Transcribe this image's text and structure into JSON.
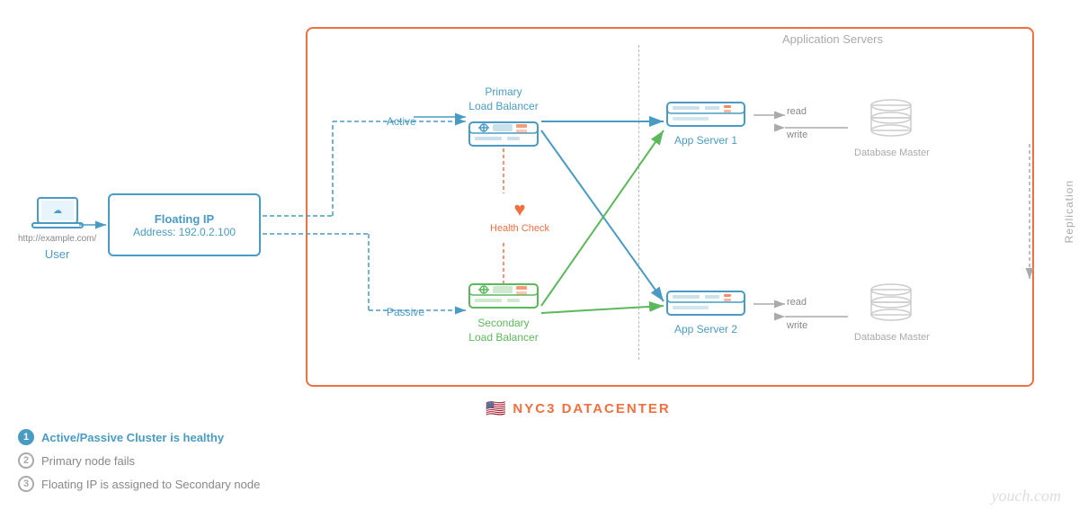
{
  "datacenter": {
    "name": "NYC3 DATACENTER",
    "flag": "🇺🇸"
  },
  "app_servers_label": "Application Servers",
  "replication_label": "Replication",
  "user": {
    "label": "User",
    "url": "http://example.com/"
  },
  "floating_ip": {
    "title": "Floating IP",
    "address": "Address: 192.0.2.100"
  },
  "primary_lb": {
    "line1": "Primary",
    "line2": "Load Balancer"
  },
  "secondary_lb": {
    "line1": "Secondary",
    "line2": "Load Balancer"
  },
  "active_label": "Active",
  "passive_label": "Passive",
  "health_check": "Health Check",
  "app_server_1": "App Server 1",
  "app_server_2": "App Server 2",
  "db_master_1": "Database Master",
  "db_master_2": "Database Master",
  "read_label": "read",
  "write_label": "write",
  "legend": {
    "item1": "Active/Passive Cluster is healthy",
    "item2": "Primary node fails",
    "item3": "Floating IP is assigned to Secondary node"
  },
  "watermark": "youch.com",
  "colors": {
    "blue": "#4a9bc4",
    "orange": "#f07040",
    "green": "#5cb85c",
    "gray": "#aaaaaa"
  }
}
